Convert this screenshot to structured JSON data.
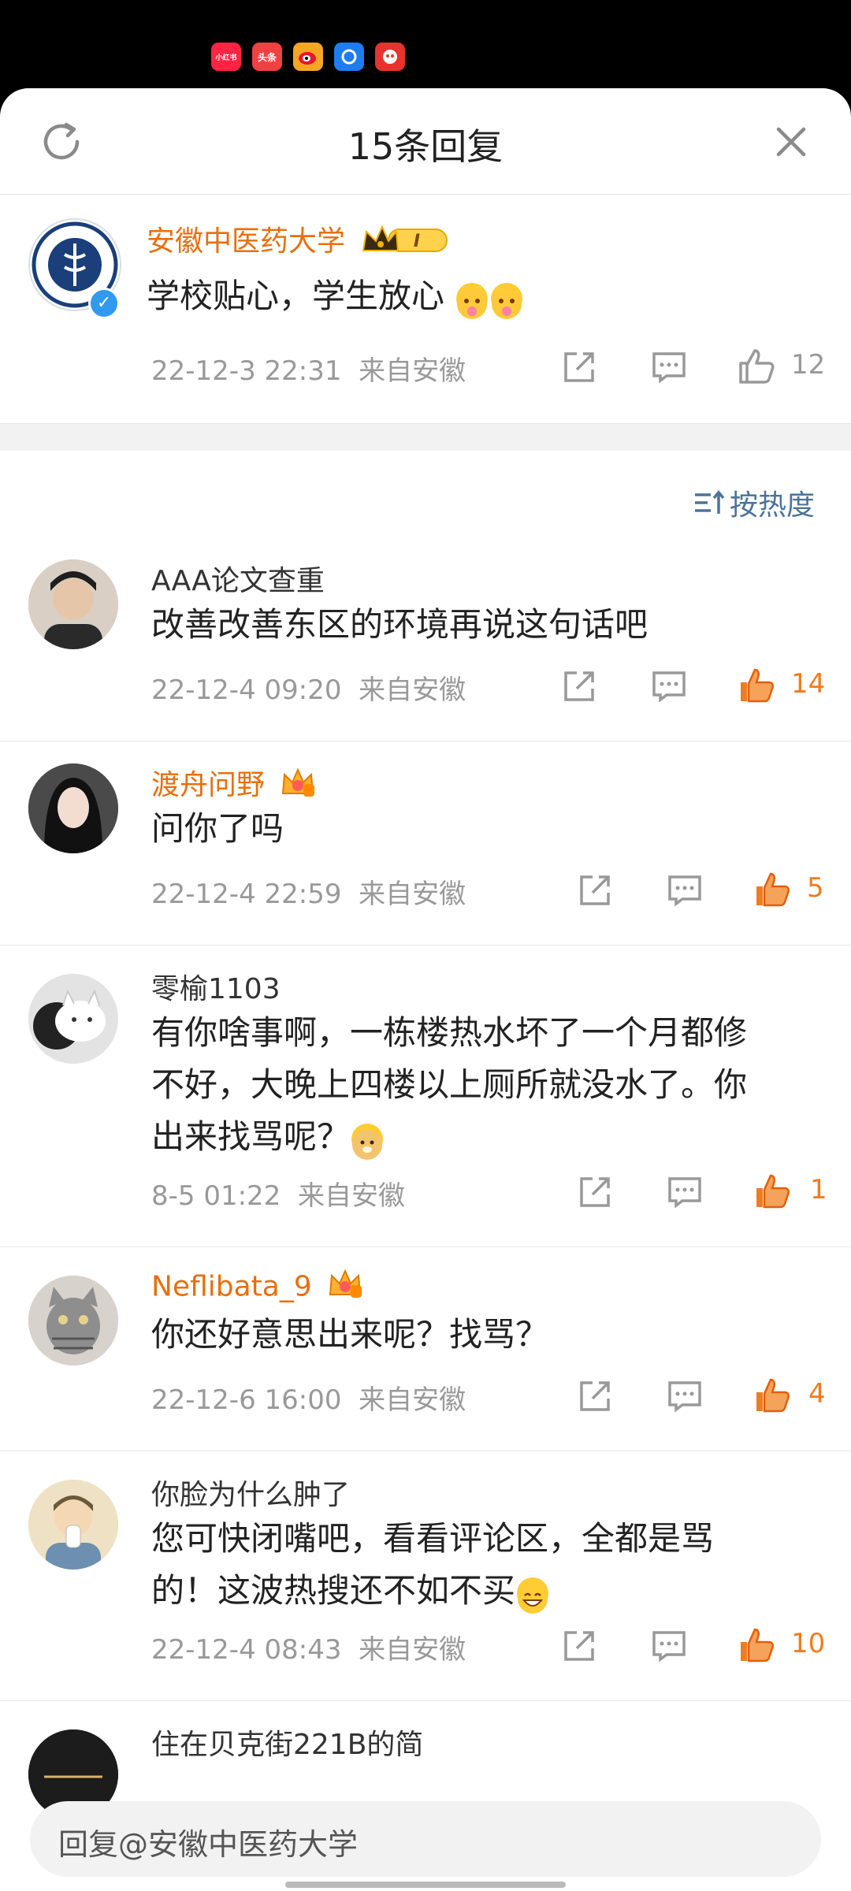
{
  "header": {
    "title": "15条回复"
  },
  "original": {
    "author": "安徽中医药大学",
    "text": "学校贴心，学生放心",
    "time": "22-12-3 22:31",
    "location": "来自安徽",
    "likes": "12"
  },
  "sort": {
    "label": "按热度"
  },
  "comments": [
    {
      "author": "AAA论文查重",
      "text_lines": [
        "改善改善东区的环境再说这句话吧"
      ],
      "time": "22-12-4 09:20",
      "location": "来自安徽",
      "likes": "14"
    },
    {
      "author": "渡舟问野",
      "text_lines": [
        "问你了吗"
      ],
      "time": "22-12-4 22:59",
      "location": "来自安徽",
      "likes": "5"
    },
    {
      "author": "零榆1103",
      "text_lines": [
        "有你啥事啊，一栋楼热水坏了一个月都修",
        "不好，大晚上四楼以上厕所就没水了。你",
        "出来找骂呢？"
      ],
      "time": "8-5 01:22",
      "location": "来自安徽",
      "likes": "1"
    },
    {
      "author": "Neflibata_9",
      "text_lines": [
        "你还好意思出来呢？找骂？"
      ],
      "time": "22-12-6 16:00",
      "location": "来自安徽",
      "likes": "4"
    },
    {
      "author": "你脸为什么肿了",
      "text_lines": [
        "您可快闭嘴吧，看看评论区，全都是骂",
        "的！这波热搜还不如不买"
      ],
      "time": "22-12-4 08:43",
      "location": "来自安徽",
      "likes": "10"
    },
    {
      "author": "住在贝克街221B的简"
    }
  ],
  "reply_bar": {
    "placeholder": "回复@安徽中医药大学"
  },
  "status_apps": [
    "小红书",
    "头条"
  ],
  "colors": {
    "orange": "#f07c1f",
    "link_blue": "#4c7399",
    "gray": "#999999"
  }
}
